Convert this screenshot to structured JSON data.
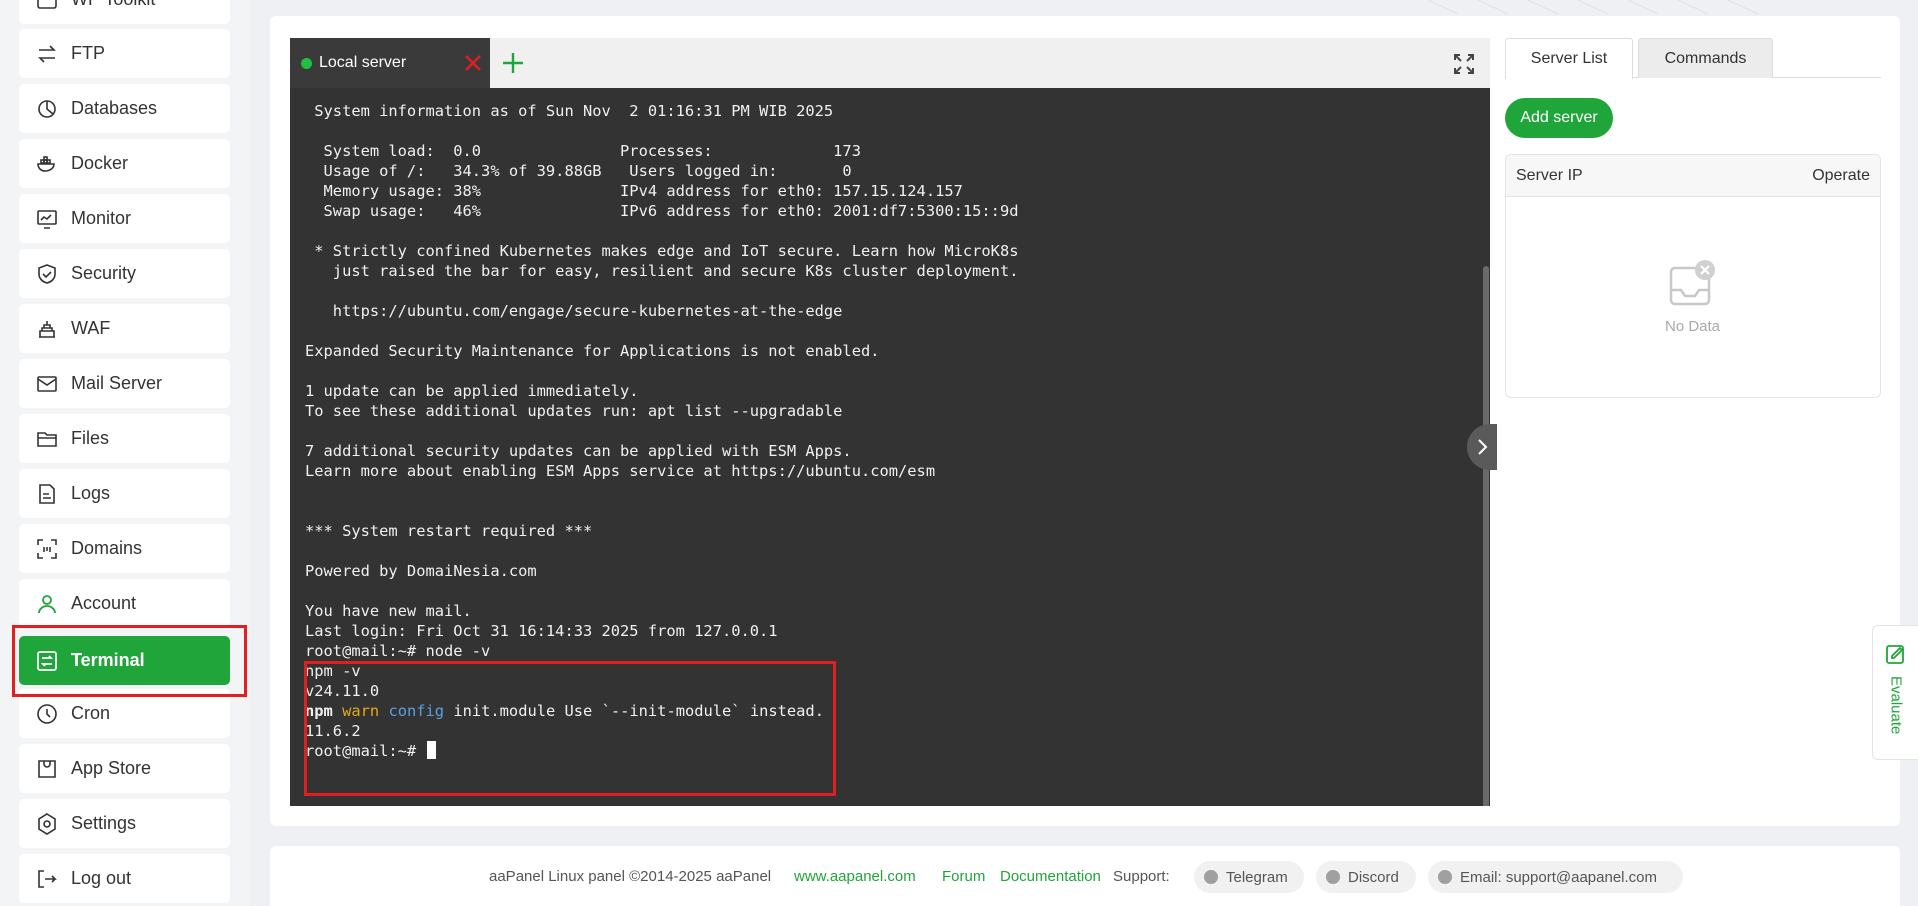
{
  "sidebar": {
    "items": [
      {
        "label": "WP Toolkit",
        "icon": "wp-icon"
      },
      {
        "label": "FTP",
        "icon": "ftp-icon"
      },
      {
        "label": "Databases",
        "icon": "database-icon"
      },
      {
        "label": "Docker",
        "icon": "docker-icon"
      },
      {
        "label": "Monitor",
        "icon": "monitor-icon"
      },
      {
        "label": "Security",
        "icon": "shield-icon"
      },
      {
        "label": "WAF",
        "icon": "waf-icon"
      },
      {
        "label": "Mail Server",
        "icon": "mail-icon"
      },
      {
        "label": "Files",
        "icon": "folder-icon"
      },
      {
        "label": "Logs",
        "icon": "log-icon"
      },
      {
        "label": "Domains",
        "icon": "domain-icon"
      },
      {
        "label": "Account",
        "icon": "user-icon"
      },
      {
        "label": "Terminal",
        "icon": "terminal-icon",
        "active": true
      },
      {
        "label": "Cron",
        "icon": "clock-icon"
      },
      {
        "label": "App Store",
        "icon": "store-icon"
      },
      {
        "label": "Settings",
        "icon": "gear-icon"
      },
      {
        "label": "Log out",
        "icon": "logout-icon"
      }
    ]
  },
  "terminal": {
    "tab_label": "Local server",
    "status_color": "#20c040",
    "lines": [
      "",
      " System information as of Sun Nov  2 01:16:31 PM WIB 2025",
      "",
      "  System load:  0.0               Processes:             173",
      "  Usage of /:   34.3% of 39.88GB   Users logged in:       0",
      "  Memory usage: 38%               IPv4 address for eth0: 157.15.124.157",
      "  Swap usage:   46%               IPv6 address for eth0: 2001:df7:5300:15::9d",
      "",
      " * Strictly confined Kubernetes makes edge and IoT secure. Learn how MicroK8s",
      "   just raised the bar for easy, resilient and secure K8s cluster deployment.",
      "",
      "   https://ubuntu.com/engage/secure-kubernetes-at-the-edge",
      "",
      "Expanded Security Maintenance for Applications is not enabled.",
      "",
      "1 update can be applied immediately.",
      "To see these additional updates run: apt list --upgradable",
      "",
      "7 additional security updates can be applied with ESM Apps.",
      "Learn more about enabling ESM Apps service at https://ubuntu.com/esm",
      "",
      "",
      "*** System restart required ***",
      "",
      "Powered by DomaiNesia.com",
      "",
      "You have new mail.",
      "Last login: Fri Oct 31 16:14:33 2025 from 127.0.0.1",
      "root@mail:~# node -v",
      "npm -v",
      "v24.11.0"
    ],
    "warn_line": {
      "npm": "npm",
      "warn": "warn",
      "config": "config",
      "rest": " init.module Use `--init-module` instead."
    },
    "after_lines": [
      "11.6.2"
    ],
    "prompt": "root@mail:~# "
  },
  "right_panel": {
    "tabs": [
      "Server List",
      "Commands"
    ],
    "add_server_label": "Add server",
    "table_headers": [
      "Server IP",
      "Operate"
    ],
    "empty_text": "No Data"
  },
  "evaluate_label": "Evaluate",
  "footer": {
    "copyright": "aaPanel Linux panel ©2014-2025 aaPanel",
    "links": [
      "www.aapanel.com",
      "Forum",
      "Documentation"
    ],
    "support_label": "Support:",
    "pills": [
      "Telegram",
      "Discord",
      "Email: support@aapanel.com"
    ]
  },
  "colors": {
    "brand_green": "#20a53a",
    "highlight_red": "#e02020",
    "terminal_bg": "#333333"
  }
}
